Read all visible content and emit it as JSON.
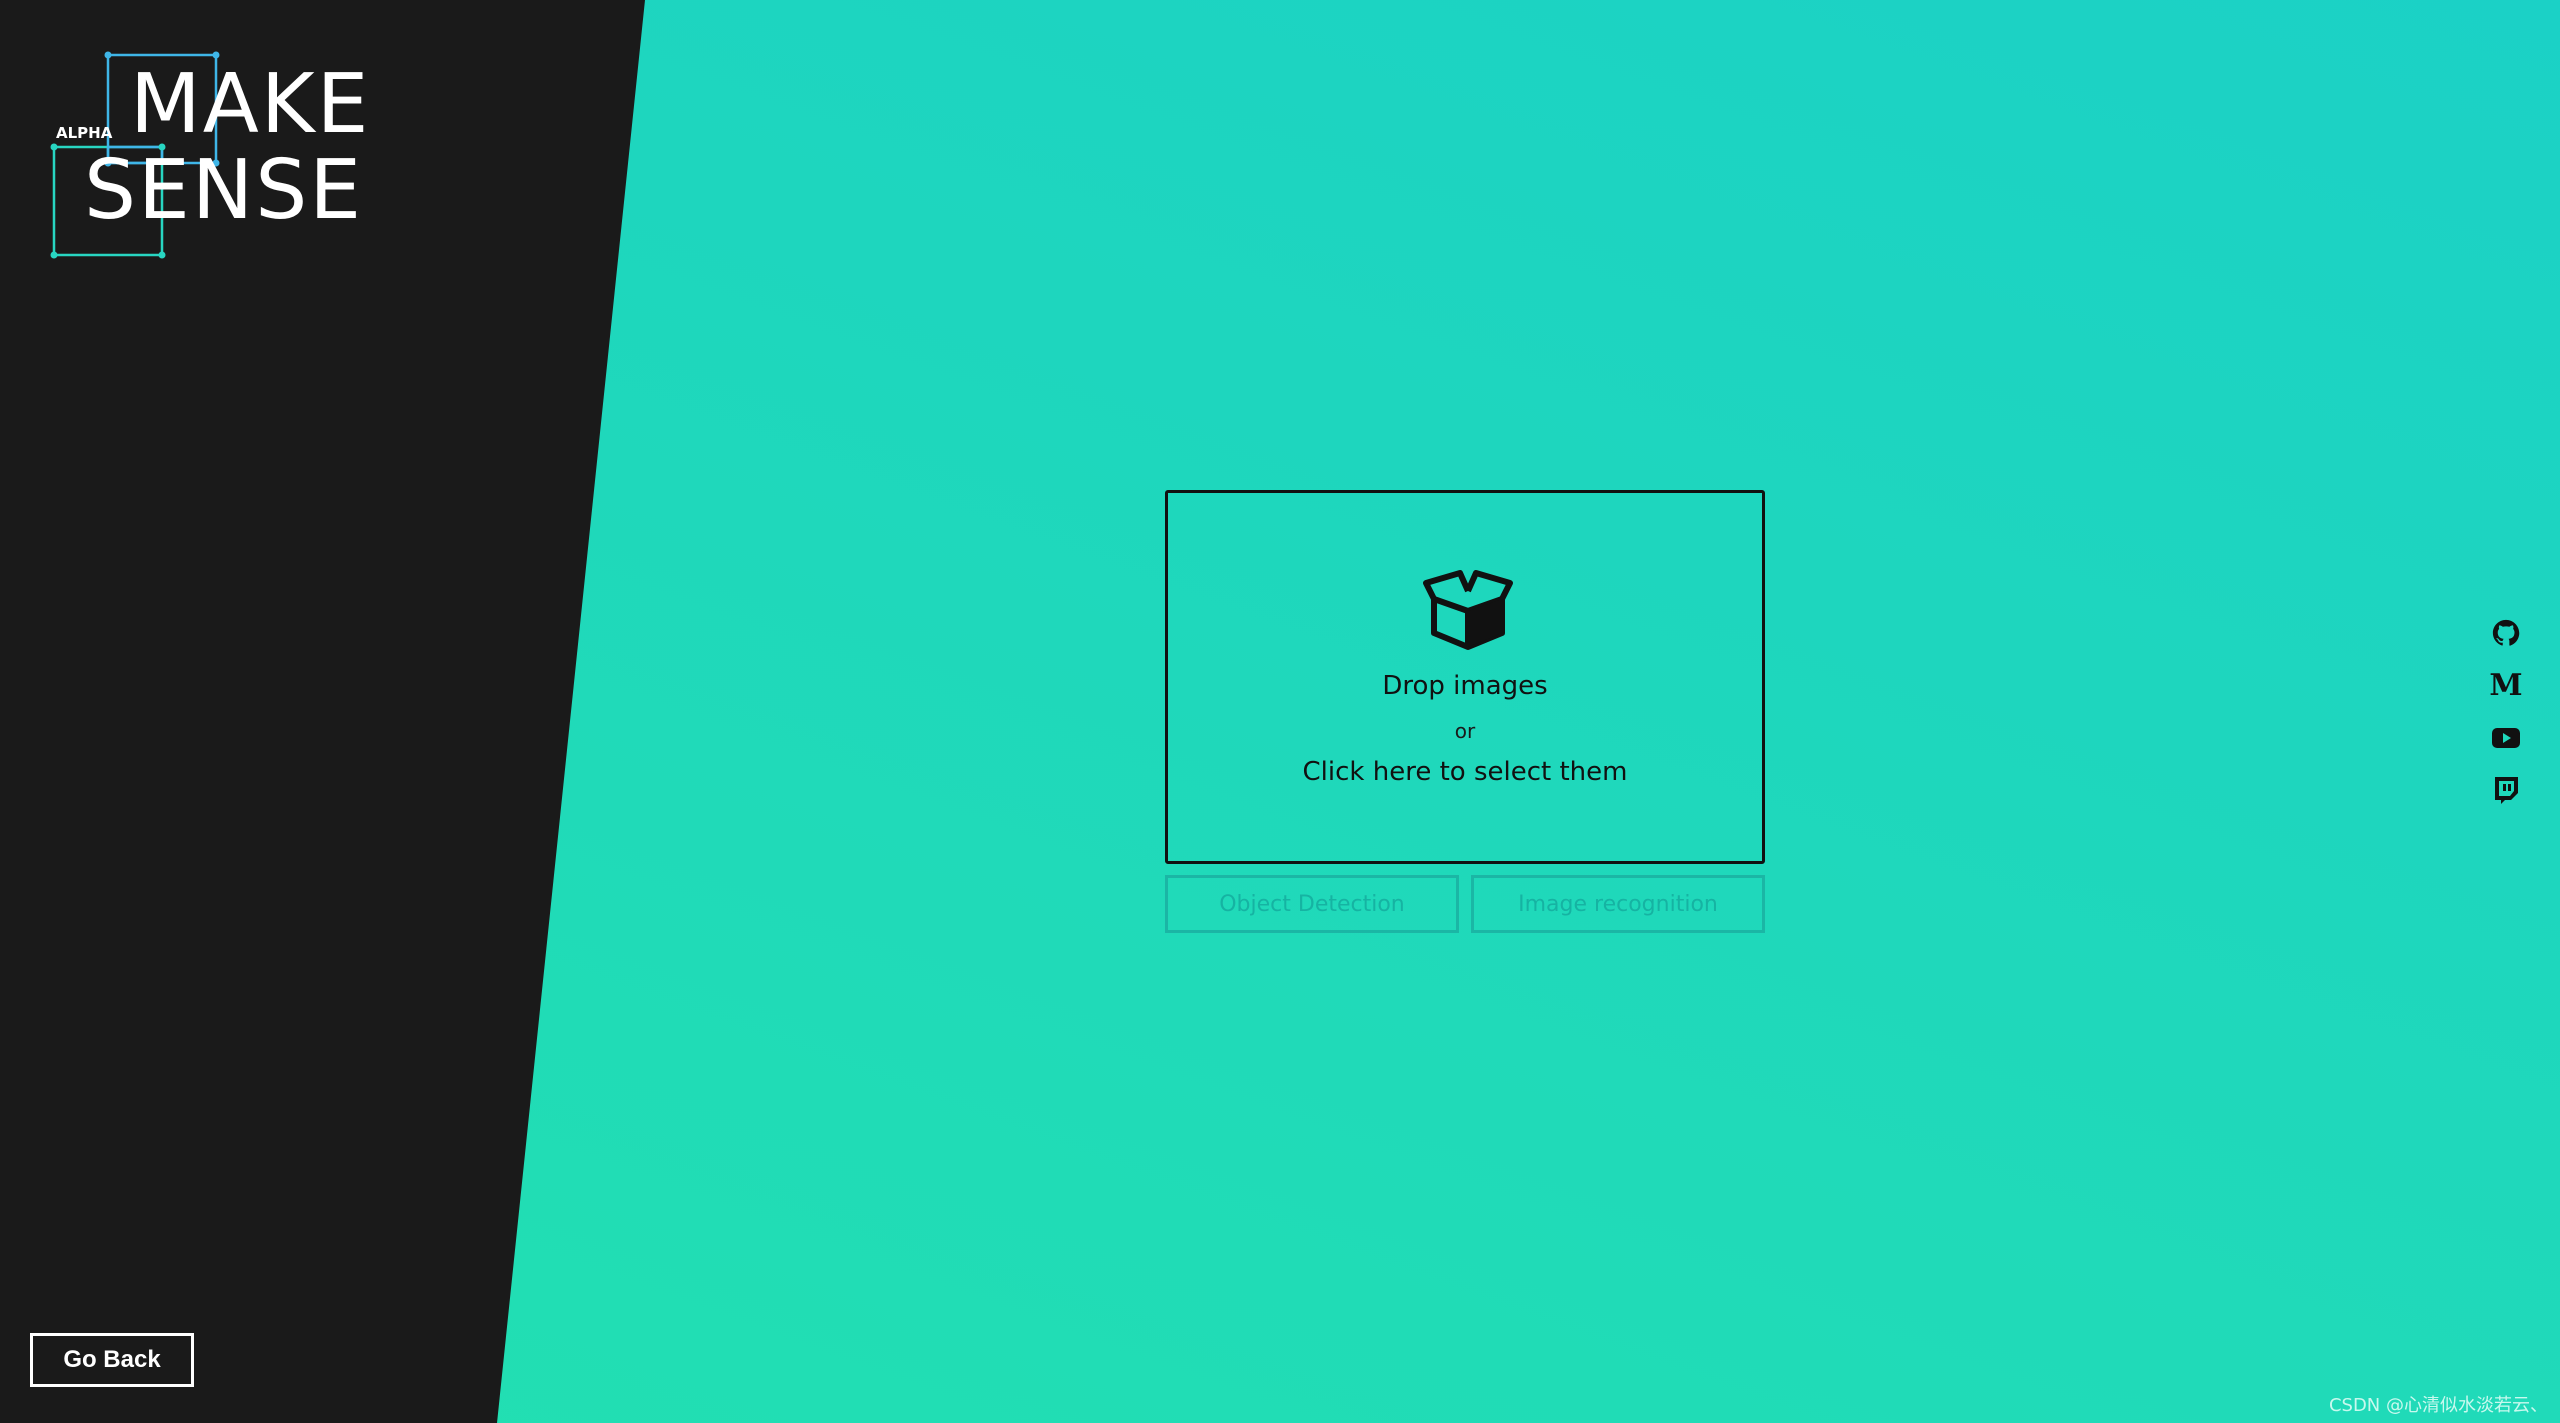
{
  "logo": {
    "alpha": "ALPHA",
    "line1": "MAKE",
    "line2": "SENSE"
  },
  "nav": {
    "go_back_label": "Go Back"
  },
  "drop_zone": {
    "icon": "box-open-icon",
    "title": "Drop images",
    "or": "or",
    "select": "Click here to select them"
  },
  "modes": [
    {
      "label": "Object Detection"
    },
    {
      "label": "Image recognition"
    }
  ],
  "social": [
    {
      "icon": "github-icon"
    },
    {
      "icon": "medium-icon",
      "glyph": "M"
    },
    {
      "icon": "youtube-icon"
    },
    {
      "icon": "twitch-icon"
    }
  ],
  "watermark": "CSDN @心清似水淡若云、",
  "colors": {
    "panel": "#1a1a1a",
    "accent": "#1fd8bb",
    "logo_frame": "#3fb6e8",
    "logo_frame_alt": "#28d6c2"
  }
}
